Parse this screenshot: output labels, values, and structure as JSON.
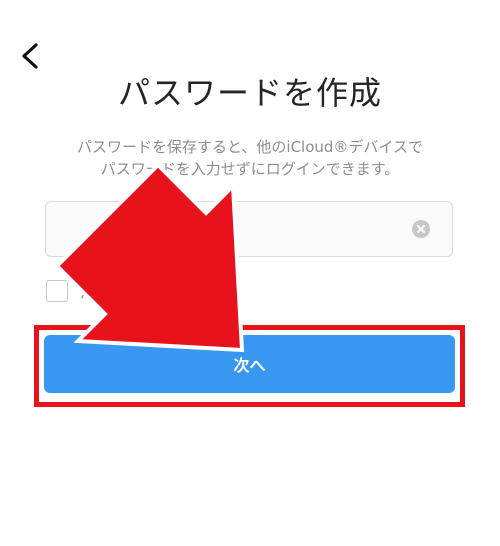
{
  "header": {
    "back_icon": "chevron-left-icon",
    "title": "パスワードを作成"
  },
  "description": {
    "line1": "パスワードを保存すると、他のiCloud®デバイスで",
    "line2": "パスワードを入力せずにログインできます。"
  },
  "password_field": {
    "value": "",
    "placeholder": "",
    "clear_icon": "clear-circle-icon"
  },
  "save_password": {
    "label": "パスワード",
    "checked": false
  },
  "next_button": {
    "label": "次へ"
  },
  "colors": {
    "button_blue": "#3897f0",
    "annotation_red": "#e8121c",
    "text_gray": "#8e8e8e",
    "title_dark": "#262626"
  }
}
